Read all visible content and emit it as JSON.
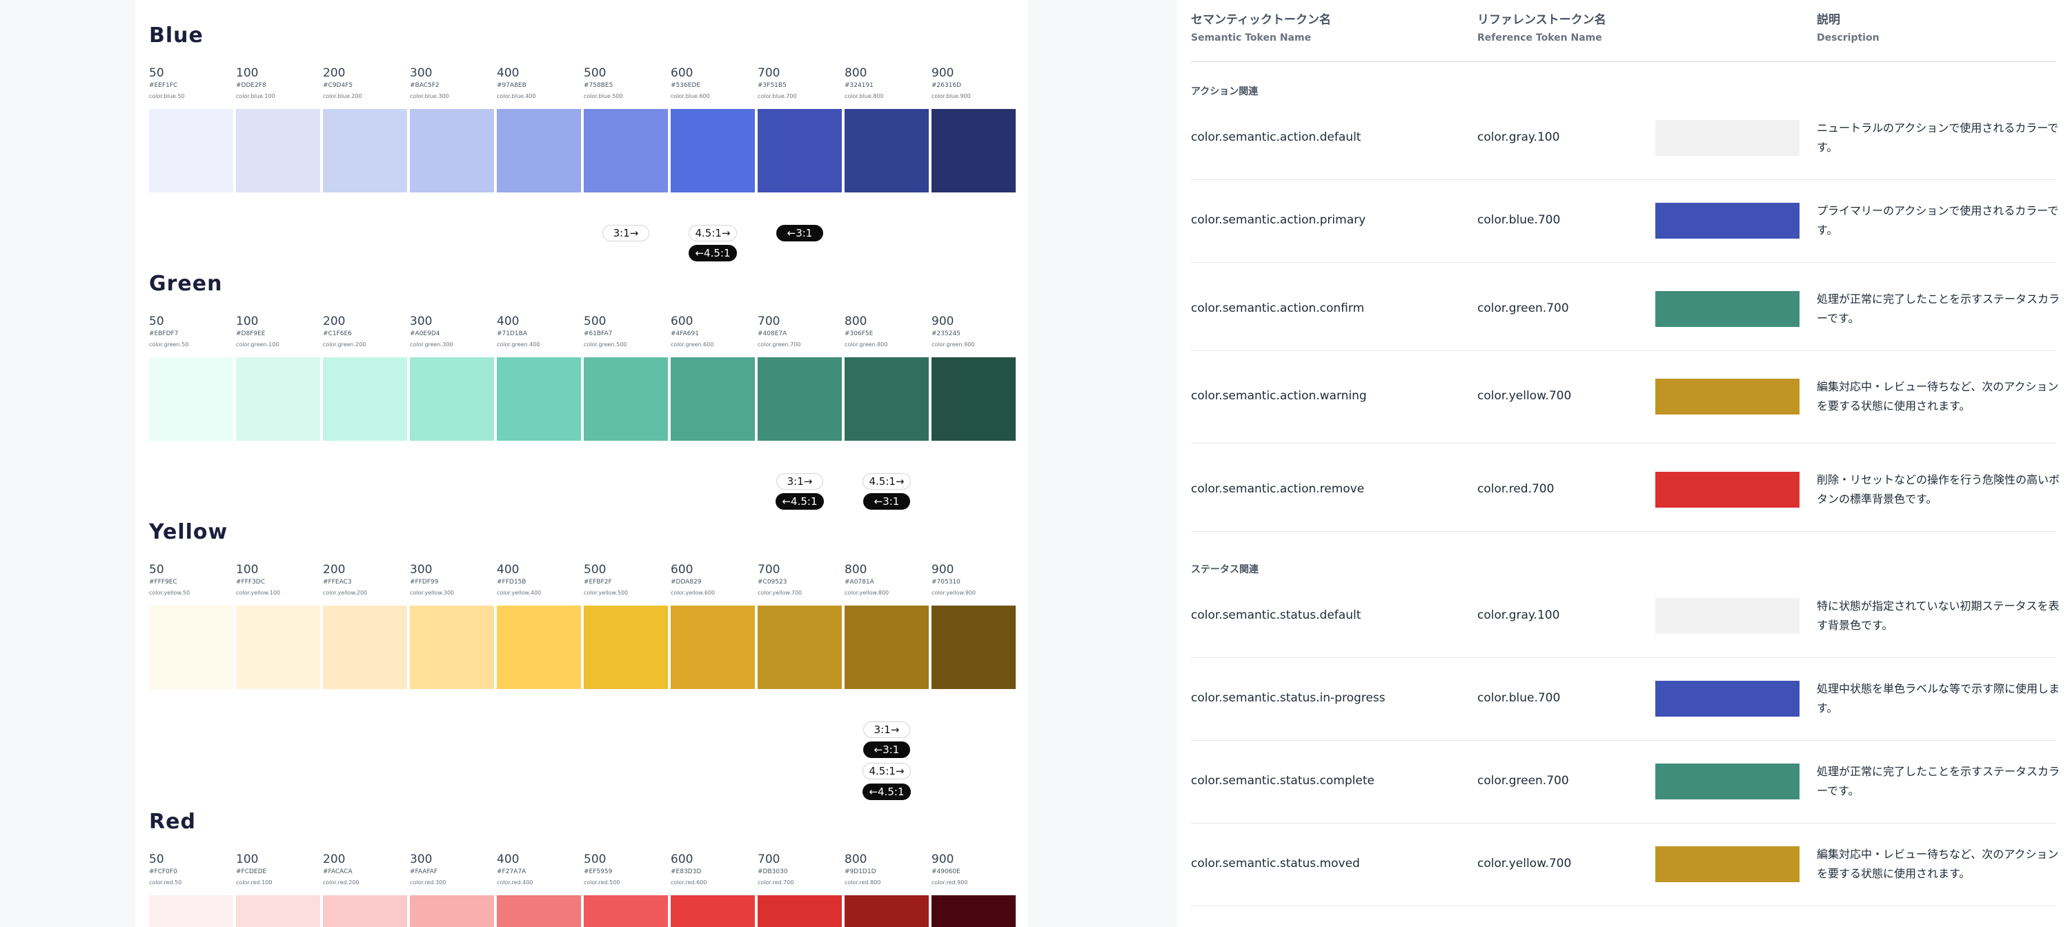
{
  "palettes": [
    {
      "name": "Blue",
      "steps": [
        {
          "n": "50",
          "hex": "#EEF1FC",
          "token": "color.blue.50",
          "color": "#EEF1FC"
        },
        {
          "n": "100",
          "hex": "#DDE2F8",
          "token": "color.blue.100",
          "color": "#DDE2F8"
        },
        {
          "n": "200",
          "hex": "#C9D4F5",
          "token": "color.blue.200",
          "color": "#C9D4F5"
        },
        {
          "n": "300",
          "hex": "#BAC5F2",
          "token": "color.blue.300",
          "color": "#BAC5F2"
        },
        {
          "n": "400",
          "hex": "#97A8EB",
          "token": "color.blue.400",
          "color": "#97A8EB"
        },
        {
          "n": "500",
          "hex": "#758BE5",
          "token": "color.blue.500",
          "color": "#758BE5"
        },
        {
          "n": "600",
          "hex": "#536EDE",
          "token": "color.blue.600",
          "color": "#536EDE"
        },
        {
          "n": "700",
          "hex": "#3F51B5",
          "token": "color.blue.700",
          "color": "#3F51B5"
        },
        {
          "n": "800",
          "hex": "#324191",
          "token": "color.blue.800",
          "color": "#324191"
        },
        {
          "n": "900",
          "hex": "#26316D",
          "token": "color.blue.900",
          "color": "#26316D"
        }
      ],
      "badges": [
        {
          "label": "3:1→",
          "style": "outline",
          "step": 5,
          "row": 0
        },
        {
          "label": "4.5:1→",
          "style": "outline",
          "step": 6,
          "row": 0
        },
        {
          "label": "←4.5:1",
          "style": "solid",
          "step": 6,
          "row": 1
        },
        {
          "label": "←3:1",
          "style": "solid",
          "step": 7,
          "row": 0
        }
      ]
    },
    {
      "name": "Green",
      "steps": [
        {
          "n": "50",
          "hex": "#EBFDF7",
          "token": "color.green.50",
          "color": "#EBFDF7"
        },
        {
          "n": "100",
          "hex": "#D8F9EE",
          "token": "color.green.100",
          "color": "#D8F9EE"
        },
        {
          "n": "200",
          "hex": "#C1F6E6",
          "token": "color.green.200",
          "color": "#C1F6E6"
        },
        {
          "n": "300",
          "hex": "#A0E9D4",
          "token": "color.green.300",
          "color": "#A0E9D4"
        },
        {
          "n": "400",
          "hex": "#71D1BA",
          "token": "color.green.400",
          "color": "#71D1BA"
        },
        {
          "n": "500",
          "hex": "#61BFA7",
          "token": "color.green.500",
          "color": "#61BFA7"
        },
        {
          "n": "600",
          "hex": "#4FA691",
          "token": "color.green.600",
          "color": "#4FA691"
        },
        {
          "n": "700",
          "hex": "#408E7A",
          "token": "color.green.700",
          "color": "#408E7A"
        },
        {
          "n": "800",
          "hex": "#306F5E",
          "token": "color.green.800",
          "color": "#306F5E"
        },
        {
          "n": "900",
          "hex": "#235245",
          "token": "color.green.900",
          "color": "#235245"
        }
      ],
      "badges": [
        {
          "label": "3:1→",
          "style": "outline",
          "step": 7,
          "row": 0
        },
        {
          "label": "←4.5:1",
          "style": "solid",
          "step": 7,
          "row": 1
        },
        {
          "label": "4.5:1→",
          "style": "outline",
          "step": 8,
          "row": 0
        },
        {
          "label": "←3:1",
          "style": "solid",
          "step": 8,
          "row": 1
        }
      ]
    },
    {
      "name": "Yellow",
      "steps": [
        {
          "n": "50",
          "hex": "#FFF9EC",
          "token": "color.yellow.50",
          "color": "#FFF9EC"
        },
        {
          "n": "100",
          "hex": "#FFF3DC",
          "token": "color.yellow.100",
          "color": "#FFF3DC"
        },
        {
          "n": "200",
          "hex": "#FFEAC3",
          "token": "color.yellow.200",
          "color": "#FFEAC3"
        },
        {
          "n": "300",
          "hex": "#FFDF99",
          "token": "color.yellow.300",
          "color": "#FFDF99"
        },
        {
          "n": "400",
          "hex": "#FFD15B",
          "token": "color.yellow.400",
          "color": "#FFD15B"
        },
        {
          "n": "500",
          "hex": "#EFBF2F",
          "token": "color.yellow.500",
          "color": "#EFBF2F"
        },
        {
          "n": "600",
          "hex": "#DDA829",
          "token": "color.yellow.600",
          "color": "#DDA829"
        },
        {
          "n": "700",
          "hex": "#C09523",
          "token": "color.yellow.700",
          "color": "#C09523"
        },
        {
          "n": "800",
          "hex": "#A0781A",
          "token": "color.yellow.800",
          "color": "#A0781A"
        },
        {
          "n": "900",
          "hex": "#705310",
          "token": "color.yellow.900",
          "color": "#705310"
        }
      ],
      "badges": [
        {
          "label": "3:1→",
          "style": "outline",
          "step": 8,
          "row": 0
        },
        {
          "label": "←3:1",
          "style": "solid",
          "step": 8,
          "row": 1
        },
        {
          "label": "4.5:1→",
          "style": "outline",
          "step": 8,
          "row": 2
        },
        {
          "label": "←4.5:1",
          "style": "solid",
          "step": 8,
          "row": 3
        }
      ]
    },
    {
      "name": "Red",
      "steps": [
        {
          "n": "50",
          "hex": "#FCF0F0",
          "token": "color.red.50",
          "color": "#FCF0F0"
        },
        {
          "n": "100",
          "hex": "#FCDEDE",
          "token": "color.red.100",
          "color": "#FCDEDE"
        },
        {
          "n": "200",
          "hex": "#FACACA",
          "token": "color.red.200",
          "color": "#FACACA"
        },
        {
          "n": "300",
          "hex": "#FAAFAF",
          "token": "color.red.300",
          "color": "#FAAFAF"
        },
        {
          "n": "400",
          "hex": "#F27A7A",
          "token": "color.red.400",
          "color": "#F27A7A"
        },
        {
          "n": "500",
          "hex": "#EF5959",
          "token": "color.red.500",
          "color": "#EF5959"
        },
        {
          "n": "600",
          "hex": "#E83D3D",
          "token": "color.red.600",
          "color": "#E83D3D"
        },
        {
          "n": "700",
          "hex": "#DB3030",
          "token": "color.red.700",
          "color": "#DB3030"
        },
        {
          "n": "800",
          "hex": "#9D1D1D",
          "token": "color.red.800",
          "color": "#9D1D1D"
        },
        {
          "n": "900",
          "hex": "#49060E",
          "token": "color.red.900",
          "color": "#49060E"
        }
      ],
      "badges": []
    }
  ],
  "table": {
    "headers": [
      {
        "jp": "セマンティックトークン名",
        "en": "Semantic Token Name"
      },
      {
        "jp": "リファレンストークン名",
        "en": "Reference Token Name"
      },
      {
        "jp": "説明",
        "en": "Description"
      }
    ],
    "groups": [
      {
        "label": "アクション関連",
        "rows": [
          {
            "semantic": "color.semantic.action.default",
            "reference": "color.gray.100",
            "swatch": "#F2F2F2",
            "desc": "ニュートラルのアクションで使用されるカラーです。"
          },
          {
            "semantic": "color.semantic.action.primary",
            "reference": "color.blue.700",
            "swatch": "#3F51B5",
            "desc": "プライマリーのアクションで使用されるカラーです。"
          },
          {
            "semantic": "color.semantic.action.confirm",
            "reference": "color.green.700",
            "swatch": "#408E7A",
            "desc": "処理が正常に完了したことを示すステータスカラーです。"
          },
          {
            "semantic": "color.semantic.action.warning",
            "reference": "color.yellow.700",
            "swatch": "#C09523",
            "desc": "編集対応中・レビュー待ちなど、次のアクションを要する状態に使用されます。"
          },
          {
            "semantic": "color.semantic.action.remove",
            "reference": "color.red.700",
            "swatch": "#DB3030",
            "desc": "削除・リセットなどの操作を行う危険性の高いボタンの標準背景色です。"
          }
        ]
      },
      {
        "label": "ステータス関連",
        "rows": [
          {
            "semantic": "color.semantic.status.default",
            "reference": "color.gray.100",
            "swatch": "#F2F2F2",
            "desc": "特に状態が指定されていない初期ステータスを表す背景色です。"
          },
          {
            "semantic": "color.semantic.status.in-progress",
            "reference": "color.blue.700",
            "swatch": "#3F51B5",
            "desc": "処理中状態を単色ラベルな等で示す際に使用します。"
          },
          {
            "semantic": "color.semantic.status.complete",
            "reference": "color.green.700",
            "swatch": "#408E7A",
            "desc": "処理が正常に完了したことを示すステータスカラーです。"
          },
          {
            "semantic": "color.semantic.status.moved",
            "reference": "color.yellow.700",
            "swatch": "#C09523",
            "desc": "編集対応中・レビュー待ちなど、次のアクションを要する状態に使用されます。"
          }
        ]
      }
    ]
  }
}
